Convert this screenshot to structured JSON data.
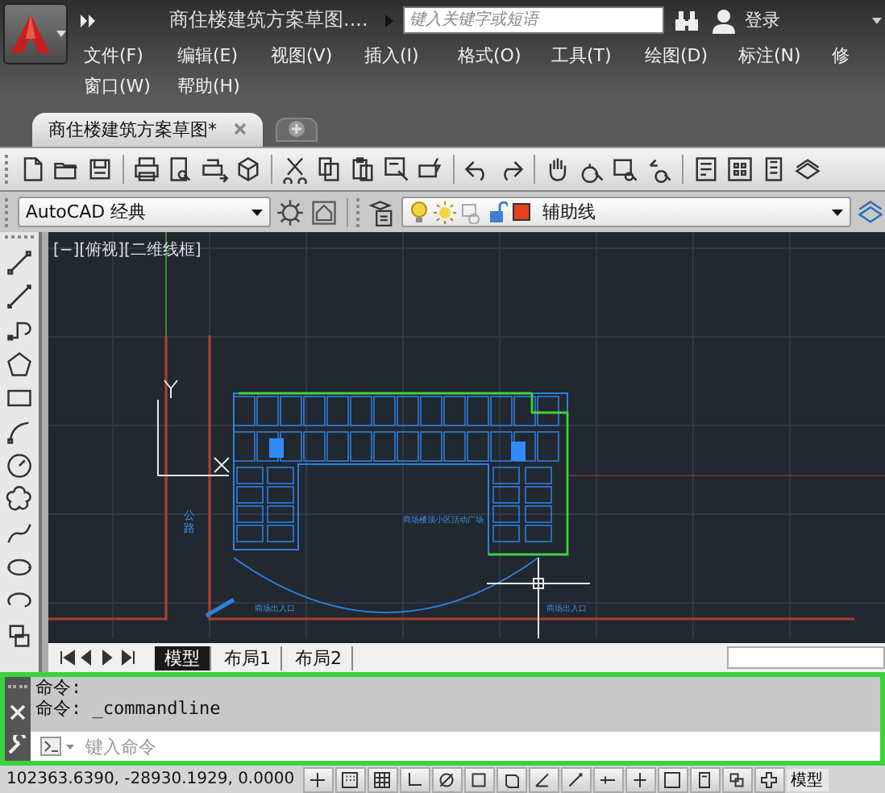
{
  "app_title": "商住楼建筑方案草图....",
  "search": {
    "placeholder": "键入关键字或短语"
  },
  "sign_in": "登录",
  "menu_rows": [
    [
      {
        "label": "文件(F)"
      },
      {
        "label": "编辑(E)"
      },
      {
        "label": "视图(V)"
      },
      {
        "label": "插入(I)"
      },
      {
        "label": "格式(O)"
      },
      {
        "label": "工具(T)"
      },
      {
        "label": "绘图(D)"
      },
      {
        "label": "标注(N)"
      },
      {
        "label": "修"
      }
    ],
    [
      {
        "label": "窗口(W)"
      },
      {
        "label": "帮助(H)"
      }
    ]
  ],
  "doc_tabs": [
    {
      "label": "商住楼建筑方案草图*",
      "selected": true
    }
  ],
  "workspace": "AutoCAD 经典",
  "layer": {
    "name": "辅助线",
    "color": "#e8401c"
  },
  "viewport_label": "[−][俯视][二维线框]",
  "drawing_labels": [
    "公路",
    "商场楼顶小区活动广场",
    "商场出入口",
    "商场出入口"
  ],
  "layout_tabs": [
    {
      "label": "模型",
      "selected": true
    },
    {
      "label": "布局1",
      "selected": false
    },
    {
      "label": "布局2",
      "selected": false
    }
  ],
  "command_history": [
    "命令:",
    "命令: _commandline"
  ],
  "command_input": {
    "placeholder": "键入命令"
  },
  "status": {
    "coordinates": "102363.6390, -28930.1929, 0.0000",
    "mode": "模型"
  }
}
